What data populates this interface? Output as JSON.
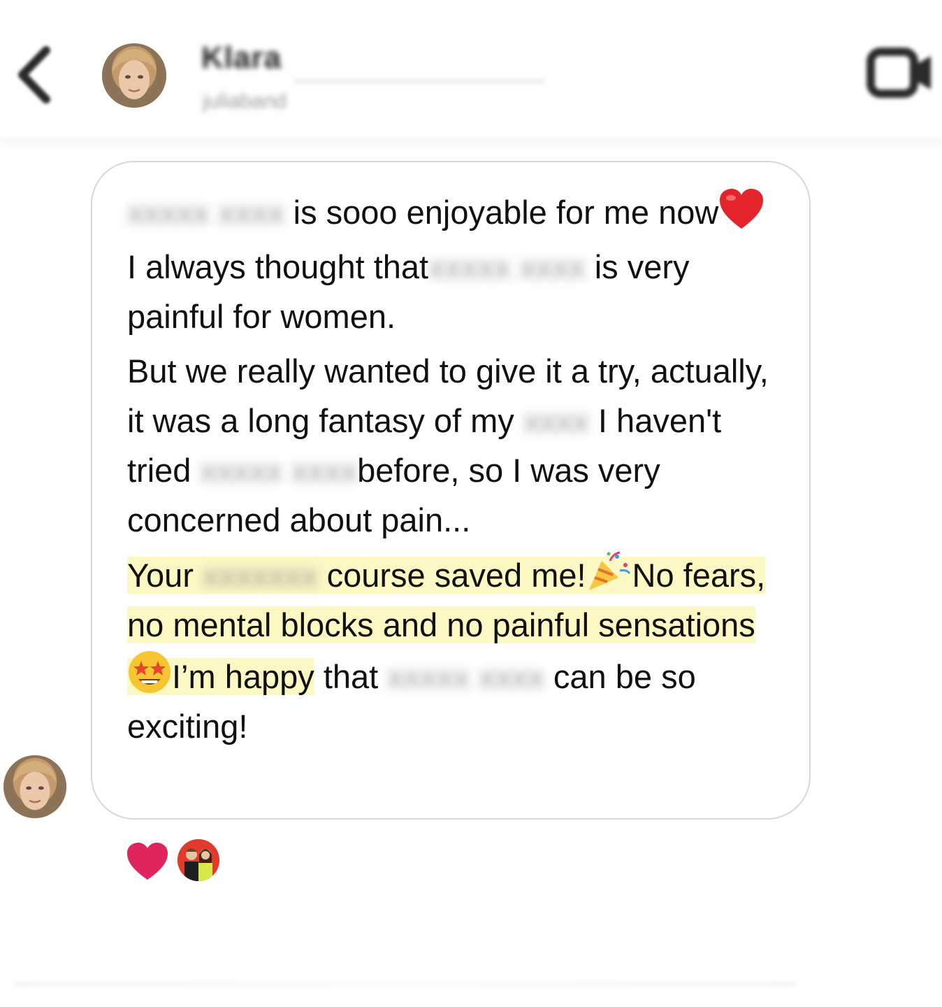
{
  "header": {
    "name": "Klara",
    "handle": "juliaband",
    "back_icon": "chevron-left-icon",
    "video_icon": "video-call-icon"
  },
  "message": {
    "line1_blur": "xxxxx xxxx",
    "line1_text": " is sooo enjoyable for me now",
    "line2_a": "I always thought that",
    "line2_blur": "xxxxx xxxx",
    "line2_b": " is very painful for women.",
    "line3_a": "But we really wanted to give it a try, actually, it was a long fantasy of my",
    "line3_blur1": "xxxx",
    "line3_b": " I haven't tried",
    "line3_blur2": "xxxxx xxxx",
    "line3_c": "before, so I was very concerned about pain...",
    "hl_a": "Your",
    "hl_blur": "xxxxxxx",
    "hl_b": " course saved me!",
    "hl_c": "No fears, no mental blocks and no painful sensations",
    "hl_d": "I’m happy",
    "tail_a": " that",
    "tail_blur": "xxxxx xxxx",
    "tail_b": " can be so exciting!"
  },
  "reactions": {
    "heart_icon": "heart-icon",
    "heart_color": "#e0245e"
  },
  "colors": {
    "highlight": "#fbf8c4",
    "bubble_border": "#d8d8d8"
  }
}
